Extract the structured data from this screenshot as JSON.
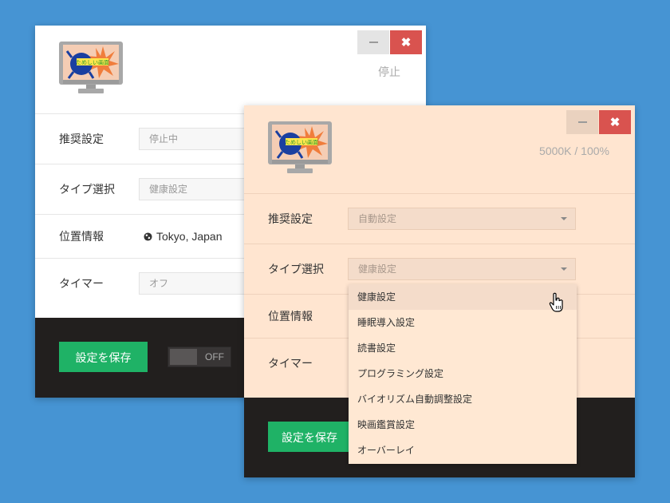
{
  "window_back": {
    "minimize_icon": "minimize-icon",
    "close_icon": "close-icon",
    "status": "停止",
    "settings": [
      {
        "label": "推奨設定",
        "value": "停止中"
      },
      {
        "label": "タイプ選択",
        "value": "健康設定"
      },
      {
        "label": "位置情報",
        "value": "Tokyo, Japan"
      },
      {
        "label": "タイマー",
        "value": "オフ"
      }
    ],
    "save_label": "設定を保存",
    "toggle_label": "OFF"
  },
  "window_front": {
    "minimize_icon": "minimize-icon",
    "close_icon": "close-icon",
    "status": "5000K / 100%",
    "settings": [
      {
        "label": "推奨設定",
        "value": "自動設定"
      },
      {
        "label": "タイプ選択",
        "value": "健康設定"
      },
      {
        "label": "位置情報"
      },
      {
        "label": "タイマー"
      }
    ],
    "save_label": "設定を保存"
  },
  "dropdown": {
    "options": [
      "健康設定",
      "睡眠導入設定",
      "読書設定",
      "プログラミング設定",
      "バイオリズム自動調整設定",
      "映画鑑賞設定",
      "オーバーレイ"
    ],
    "hovered_index": 0
  },
  "monitor_logo_text": "ためしい画面",
  "colors": {
    "desktop": "#4694d3",
    "front_window_bg": "#ffe5d0",
    "save_button": "#1fb266",
    "close_button": "#d9534f",
    "footer": "#221f1e"
  }
}
